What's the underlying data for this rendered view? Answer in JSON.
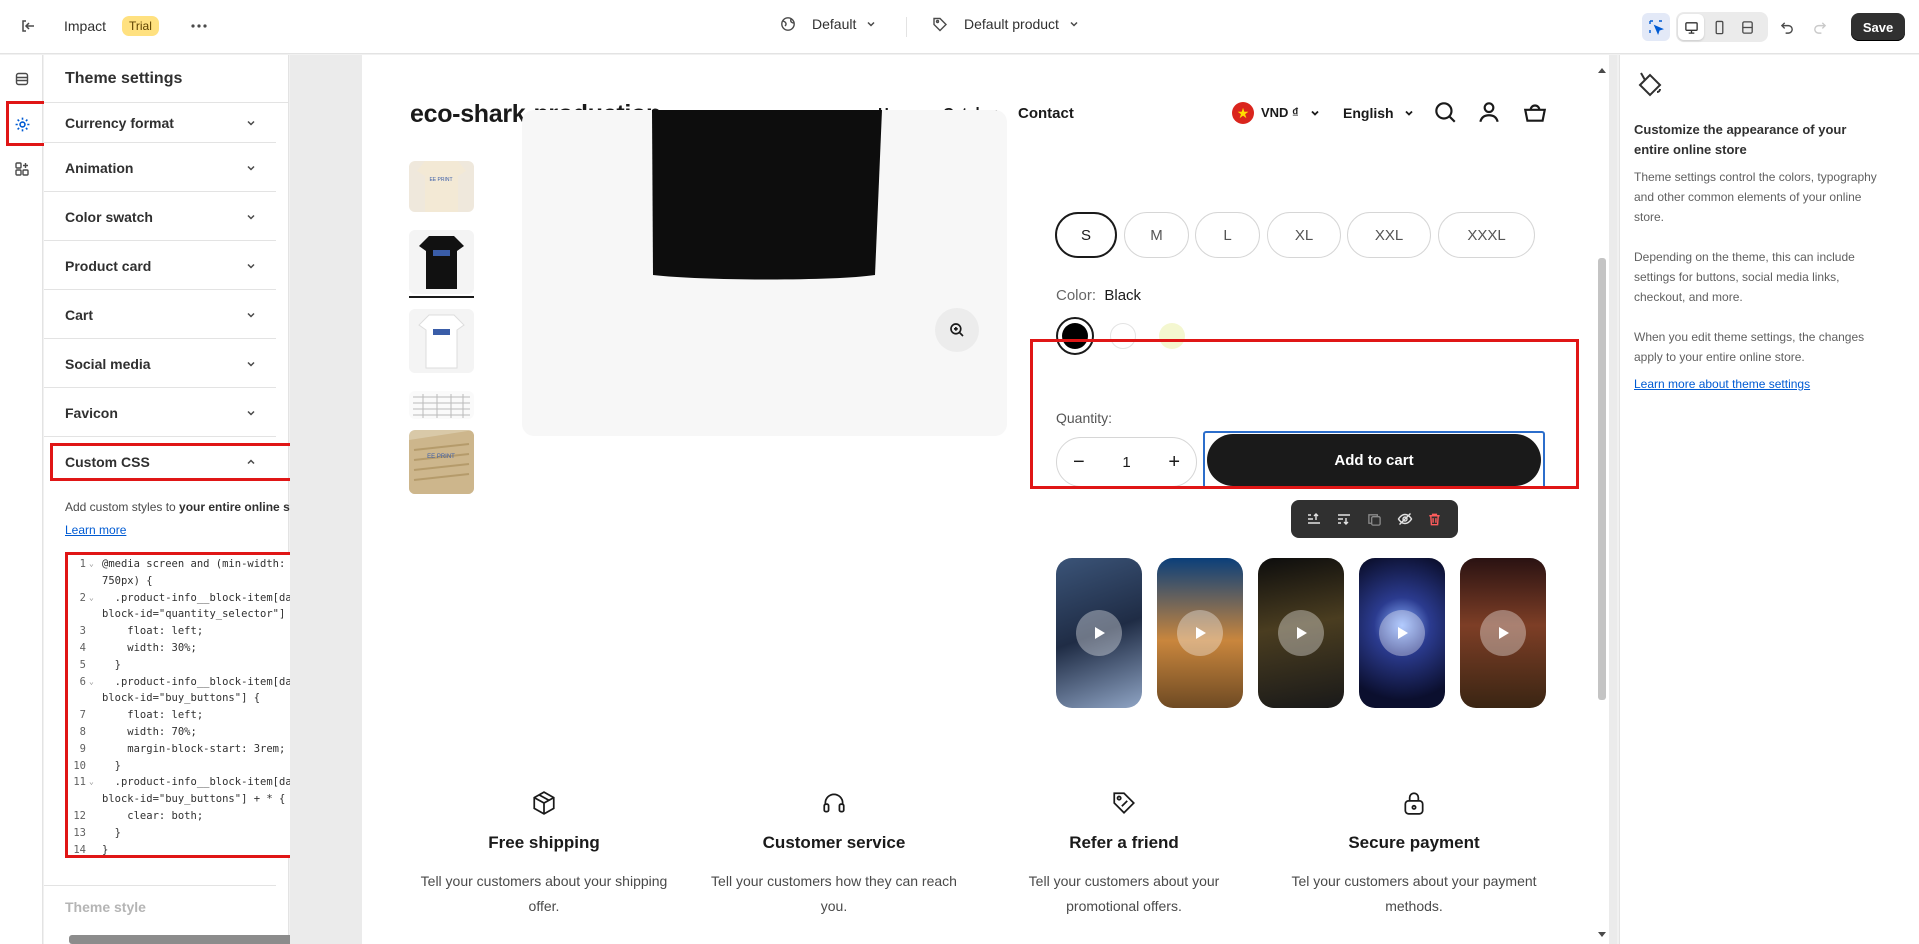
{
  "topbar": {
    "theme_name": "Impact",
    "badge": "Trial",
    "template": "Default",
    "product": "Default product",
    "save_label": "Save"
  },
  "panel": {
    "title": "Theme settings",
    "sections": [
      {
        "label": "Currency format",
        "expanded": false
      },
      {
        "label": "Animation",
        "expanded": false
      },
      {
        "label": "Color swatch",
        "expanded": false
      },
      {
        "label": "Product card",
        "expanded": false
      },
      {
        "label": "Cart",
        "expanded": false
      },
      {
        "label": "Social media",
        "expanded": false
      },
      {
        "label": "Favicon",
        "expanded": false
      },
      {
        "label": "Custom CSS",
        "expanded": true
      }
    ],
    "custom_css": {
      "desc_prefix": "Add custom styles to ",
      "desc_bold": "your entire online store.",
      "learn_more": "Learn more",
      "code_lines": [
        {
          "n": "1",
          "fold": true,
          "text": "@media screen and (min-width:"
        },
        {
          "n": "",
          "fold": false,
          "text": "750px) {"
        },
        {
          "n": "2",
          "fold": true,
          "text": "  .product-info__block-item[data-"
        },
        {
          "n": "",
          "fold": false,
          "text": "block-id=\"quantity_selector\"] {"
        },
        {
          "n": "3",
          "fold": false,
          "text": "    float: left;"
        },
        {
          "n": "4",
          "fold": false,
          "text": "    width: 30%;"
        },
        {
          "n": "5",
          "fold": false,
          "text": "  }"
        },
        {
          "n": "6",
          "fold": true,
          "text": "  .product-info__block-item[data-"
        },
        {
          "n": "",
          "fold": false,
          "text": "block-id=\"buy_buttons\"] {"
        },
        {
          "n": "7",
          "fold": false,
          "text": "    float: left;"
        },
        {
          "n": "8",
          "fold": false,
          "text": "    width: 70%;"
        },
        {
          "n": "9",
          "fold": false,
          "text": "    margin-block-start: 3rem;"
        },
        {
          "n": "10",
          "fold": false,
          "text": "  }"
        },
        {
          "n": "11",
          "fold": true,
          "text": "  .product-info__block-item[data-"
        },
        {
          "n": "",
          "fold": false,
          "text": "block-id=\"buy_buttons\"] + * {"
        },
        {
          "n": "12",
          "fold": false,
          "text": "    clear: both;"
        },
        {
          "n": "13",
          "fold": false,
          "text": "  }"
        },
        {
          "n": "14",
          "fold": false,
          "text": "}"
        }
      ]
    },
    "theme_style": "Theme style"
  },
  "store": {
    "name": "eco-shark-production",
    "nav": [
      "Home",
      "Catalog",
      "Contact"
    ],
    "currency": "VND ₫",
    "language": "English",
    "sizes": [
      "S",
      "M",
      "L",
      "XL",
      "XXL",
      "XXXL"
    ],
    "selected_size": "S",
    "color_label": "Color:",
    "color_value": "Black",
    "swatches": [
      "#000000",
      "#ffffff",
      "#f4f7d0"
    ],
    "quantity_label": "Quantity:",
    "quantity": "1",
    "add_to_cart": "Add to cart",
    "features": [
      {
        "title": "Free shipping",
        "desc": "Tell your customers about your shipping offer."
      },
      {
        "title": "Customer service",
        "desc": "Tell your customers how they can reach you."
      },
      {
        "title": "Refer a friend",
        "desc": "Tell your customers about your promotional offers."
      },
      {
        "title": "Secure payment",
        "desc": "Tel your customers about your payment methods."
      }
    ]
  },
  "right_panel": {
    "title": "Customize the appearance of your entire online store",
    "p1": "Theme settings control the colors, typography and other common elements of your online store.",
    "p2": "Depending on the theme, this can include settings for buttons, social media links, checkout, and more.",
    "p3": "When you edit theme settings, the changes apply to your entire online store.",
    "link": "Learn more about theme settings"
  },
  "colors": {
    "highlight": "#e01616",
    "link": "#005bd3",
    "primary": "#1a1a1a"
  }
}
